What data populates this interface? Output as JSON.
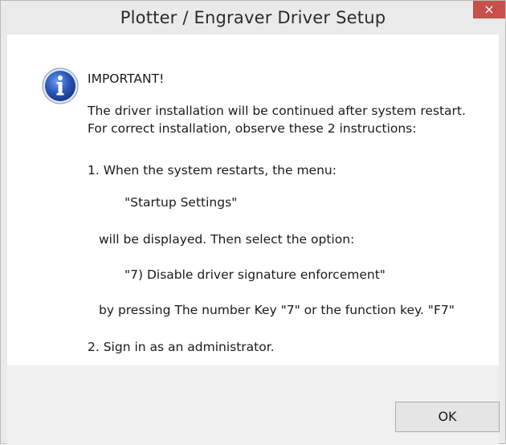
{
  "window": {
    "title": "Plotter / Engraver Driver Setup",
    "close_label": "×"
  },
  "icon": "info-icon",
  "message": {
    "heading": "IMPORTANT!",
    "line1": "The driver installation will be continued after system restart.",
    "line2": "For correct installation, observe these 2 instructions:",
    "step1": "1. When the system restarts, the menu:",
    "menu_name": "\"Startup Settings\"",
    "then_select": "will be displayed. Then select the option:",
    "option": "\"7) Disable driver signature enforcement\"",
    "by_pressing": "by pressing The number Key \"7\" or the function key. \"F7\"",
    "step2": "2. Sign in as an administrator."
  },
  "buttons": {
    "ok_label": "OK"
  },
  "colors": {
    "close_button": "#c7504c",
    "icon_blue": "#2a56b8"
  }
}
